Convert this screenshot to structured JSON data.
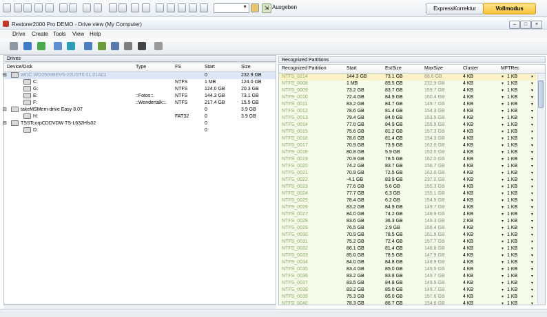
{
  "hostbar": {
    "combo_value": "",
    "output_button": "Ausgeben",
    "express_button": "ExpressKorrektur",
    "full_mode_button": "Vollmodus"
  },
  "window": {
    "title": "Restorer2000 Pro DEMO - Drive view (My Computer)",
    "buttons": [
      "–",
      "□",
      "×"
    ]
  },
  "menu": [
    "Drive",
    "Create",
    "Tools",
    "View",
    "Help"
  ],
  "drives_pane": {
    "title": "Drives",
    "columns": [
      "Device/Disk",
      "Type",
      "FS",
      "Start",
      "Size"
    ],
    "rows": [
      {
        "name": "WDC WD2500BEVS-22UST0 01.01A01",
        "type": "",
        "fs": "",
        "start": "0",
        "size": "232.9 GB",
        "indent": 0,
        "selected": true
      },
      {
        "name": "C:",
        "type": "",
        "fs": "NTFS",
        "start": "1 MB",
        "size": "124.0 GB",
        "indent": 1
      },
      {
        "name": "G:",
        "type": "",
        "fs": "NTFS",
        "start": "124.0 GB",
        "size": "20.3 GB",
        "indent": 1
      },
      {
        "name": "E:",
        "type": "::Fotos::.",
        "fs": "NTFS",
        "start": "144.3 GB",
        "size": "73.1 GB",
        "indent": 1
      },
      {
        "name": "F:",
        "type": "::Wondertalk::.",
        "fs": "NTFS",
        "start": "217.4 GB",
        "size": "15.5 GB",
        "indent": 1
      },
      {
        "name": "takeMSMem-drive Easy 8.07",
        "type": "",
        "fs": "",
        "start": "0",
        "size": "3.9 GB",
        "indent": 0
      },
      {
        "name": "H:",
        "type": "",
        "fs": "FAT32",
        "start": "0",
        "size": "3.9 GB",
        "indent": 1
      },
      {
        "name": "TSSTcorpCDDVDW TS-L632Hfs02",
        "type": "",
        "fs": "",
        "start": "0",
        "size": "",
        "indent": 0
      },
      {
        "name": "D:",
        "type": "",
        "fs": "",
        "start": "0",
        "size": "",
        "indent": 1
      }
    ]
  },
  "partitions_pane": {
    "title": "Recognized Partitions",
    "columns": [
      "Recognized Partition",
      "Start",
      "EstSize",
      "MaxSize",
      "Cluster",
      "MFTRec"
    ],
    "rows": [
      {
        "name": "NTFS_0214",
        "start": "144.3 GB",
        "est": "73.1 GB",
        "max": "88.6 GB",
        "cluster": "4 KB",
        "mft": "1 KB"
      },
      {
        "name": "NTFS_0008",
        "start": "1 MB",
        "est": "89.5 GB",
        "max": "232.9 GB",
        "cluster": "4 KB",
        "mft": "1 KB"
      },
      {
        "name": "NTFS_0009",
        "start": "73.2 GB",
        "est": "83.7 GB",
        "max": "159.7 GB",
        "cluster": "4 KB",
        "mft": "1 KB"
      },
      {
        "name": "NTFS_0010",
        "start": "72.4 GB",
        "est": "84.9 GB",
        "max": "160.4 GB",
        "cluster": "4 KB",
        "mft": "1 KB"
      },
      {
        "name": "NTFS_0011",
        "start": "83.2 GB",
        "est": "84.7 GB",
        "max": "149.7 GB",
        "cluster": "4 KB",
        "mft": "1 KB"
      },
      {
        "name": "NTFS_0012",
        "start": "78.6 GB",
        "est": "81.4 GB",
        "max": "154.3 GB",
        "cluster": "4 KB",
        "mft": "1 KB"
      },
      {
        "name": "NTFS_0013",
        "start": "79.4 GB",
        "est": "84.0 GB",
        "max": "153.5 GB",
        "cluster": "4 KB",
        "mft": "1 KB"
      },
      {
        "name": "NTFS_0014",
        "start": "77.0 GB",
        "est": "84.9 GB",
        "max": "155.9 GB",
        "cluster": "4 KB",
        "mft": "1 KB"
      },
      {
        "name": "NTFS_0015",
        "start": "75.6 GB",
        "est": "81.2 GB",
        "max": "157.3 GB",
        "cluster": "4 KB",
        "mft": "1 KB"
      },
      {
        "name": "NTFS_0016",
        "start": "78.6 GB",
        "est": "81.4 GB",
        "max": "154.3 GB",
        "cluster": "4 KB",
        "mft": "1 KB"
      },
      {
        "name": "NTFS_0017",
        "start": "70.9 GB",
        "est": "73.9 GB",
        "max": "162.0 GB",
        "cluster": "4 KB",
        "mft": "1 KB"
      },
      {
        "name": "NTFS_0018",
        "start": "80.8 GB",
        "est": "5.9 GB",
        "max": "152.0 GB",
        "cluster": "4 KB",
        "mft": "1 KB"
      },
      {
        "name": "NTFS_0019",
        "start": "70.9 GB",
        "est": "78.5 GB",
        "max": "162.0 GB",
        "cluster": "4 KB",
        "mft": "1 KB"
      },
      {
        "name": "NTFS_0020",
        "start": "74.2 GB",
        "est": "83.7 GB",
        "max": "158.7 GB",
        "cluster": "4 KB",
        "mft": "1 KB"
      },
      {
        "name": "NTFS_0021",
        "start": "70.9 GB",
        "est": "72.5 GB",
        "max": "162.0 GB",
        "cluster": "4 KB",
        "mft": "1 KB"
      },
      {
        "name": "NTFS_0022",
        "start": "-4.1 GB",
        "est": "83.9 GB",
        "max": "237.0 GB",
        "cluster": "4 KB",
        "mft": "1 KB"
      },
      {
        "name": "NTFS_0023",
        "start": "77.6 GB",
        "est": "5.6 GB",
        "max": "155.3 GB",
        "cluster": "4 KB",
        "mft": "1 KB"
      },
      {
        "name": "NTFS_0024",
        "start": "77.7 GB",
        "est": "6.3 GB",
        "max": "155.1 GB",
        "cluster": "4 KB",
        "mft": "1 KB"
      },
      {
        "name": "NTFS_0025",
        "start": "78.4 GB",
        "est": "6.2 GB",
        "max": "154.5 GB",
        "cluster": "4 KB",
        "mft": "1 KB"
      },
      {
        "name": "NTFS_0026",
        "start": "83.2 GB",
        "est": "84.9 GB",
        "max": "149.7 GB",
        "cluster": "4 KB",
        "mft": "1 KB"
      },
      {
        "name": "NTFS_0027",
        "start": "84.0 GB",
        "est": "74.2 GB",
        "max": "148.9 GB",
        "cluster": "4 KB",
        "mft": "1 KB"
      },
      {
        "name": "NTFS_0028",
        "start": "83.6 GB",
        "est": "36.3 GB",
        "max": "149.3 GB",
        "cluster": "2 KB",
        "mft": "1 KB"
      },
      {
        "name": "NTFS_0029",
        "start": "76.5 GB",
        "est": "2.9 GB",
        "max": "156.4 GB",
        "cluster": "4 KB",
        "mft": "1 KB"
      },
      {
        "name": "NTFS_0030",
        "start": "70.9 GB",
        "est": "78.5 GB",
        "max": "161.9 GB",
        "cluster": "4 KB",
        "mft": "1 KB"
      },
      {
        "name": "NTFS_0031",
        "start": "75.2 GB",
        "est": "72.4 GB",
        "max": "157.7 GB",
        "cluster": "4 KB",
        "mft": "1 KB"
      },
      {
        "name": "NTFS_0032",
        "start": "86.1 GB",
        "est": "81.4 GB",
        "max": "146.8 GB",
        "cluster": "4 KB",
        "mft": "1 KB"
      },
      {
        "name": "NTFS_0033",
        "start": "85.0 GB",
        "est": "78.5 GB",
        "max": "147.9 GB",
        "cluster": "4 KB",
        "mft": "1 KB"
      },
      {
        "name": "NTFS_0034",
        "start": "84.0 GB",
        "est": "84.8 GB",
        "max": "148.9 GB",
        "cluster": "4 KB",
        "mft": "1 KB"
      },
      {
        "name": "NTFS_0035",
        "start": "83.4 GB",
        "est": "85.0 GB",
        "max": "149.5 GB",
        "cluster": "4 KB",
        "mft": "1 KB"
      },
      {
        "name": "NTFS_0036",
        "start": "83.2 GB",
        "est": "83.8 GB",
        "max": "149.7 GB",
        "cluster": "4 KB",
        "mft": "1 KB"
      },
      {
        "name": "NTFS_0037",
        "start": "83.5 GB",
        "est": "84.8 GB",
        "max": "149.5 GB",
        "cluster": "4 KB",
        "mft": "1 KB"
      },
      {
        "name": "NTFS_0038",
        "start": "83.2 GB",
        "est": "85.0 GB",
        "max": "149.7 GB",
        "cluster": "4 KB",
        "mft": "1 KB"
      },
      {
        "name": "NTFS_0039",
        "start": "75.3 GB",
        "est": "85.0 GB",
        "max": "157.6 GB",
        "cluster": "4 KB",
        "mft": "1 KB"
      },
      {
        "name": "NTFS_0040",
        "start": "78.3 GB",
        "est": "86.7 GB",
        "max": "154.6 GB",
        "cluster": "4 KB",
        "mft": "1 KB"
      }
    ]
  },
  "colors": {
    "row_bg": "#f4fbe6",
    "row_highlight": "#fbf3c8",
    "name_text": "#8fa86a",
    "accent_gold": "#f6c23a"
  }
}
